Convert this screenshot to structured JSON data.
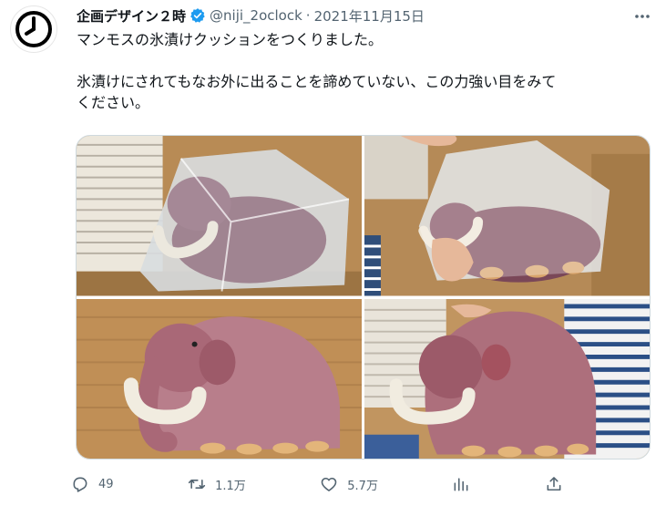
{
  "tweet": {
    "author_name": "企画デザイン２時",
    "handle": "@niji_2oclock",
    "separator": "·",
    "date": "2021年11月15日",
    "text_line1": "マンモスの氷漬けクッションをつくりました。",
    "text_line2": "氷漬けにされてもなお外に出ることを諦めていない、この力強い目をみて",
    "text_line3": "ください。"
  },
  "actions": {
    "reply_count": "49",
    "retweet_count": "1.1万",
    "like_count": "5.7万"
  },
  "icons": {
    "avatar": "clock-icon",
    "verified": "verified-badge-icon",
    "more": "more-options-icon",
    "reply": "reply-icon",
    "retweet": "retweet-icon",
    "like": "heart-icon",
    "analytics": "analytics-icon",
    "share": "share-icon"
  },
  "colors": {
    "verified": "#1d9bf0",
    "secondary_text": "#536471",
    "mammoth_fur": "#b57b86",
    "tusk": "#f1ece0"
  }
}
